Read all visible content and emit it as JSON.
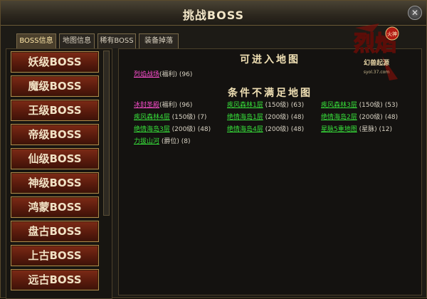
{
  "window": {
    "title": "挑战BOSS",
    "close_symbol": "✕"
  },
  "tabs": [
    {
      "label": "BOSS信息",
      "active": true
    },
    {
      "label": "地图信息",
      "active": false
    },
    {
      "label": "稀有BOSS",
      "active": false
    },
    {
      "label": "装备掉落",
      "active": false
    }
  ],
  "boss_levels": [
    "妖级BOSS",
    "魔级BOSS",
    "王级BOSS",
    "帝级BOSS",
    "仙级BOSS",
    "神级BOSS",
    "鸿蒙BOSS",
    "盘古BOSS",
    "上古BOSS",
    "远古BOSS"
  ],
  "section_enterable": {
    "heading": "可进入地图",
    "maps": [
      {
        "name": "烈焰战场",
        "tag": "(福利)",
        "level": "(96)",
        "color": "pink"
      }
    ]
  },
  "section_locked": {
    "heading": "条件不满足地图",
    "maps": [
      {
        "name": "冰封圣殿",
        "tag": "(福利)",
        "level": "(96)",
        "color": "pink"
      },
      {
        "name": "疾风森林1层",
        "tag": "(150级)",
        "level": "(63)",
        "color": "green"
      },
      {
        "name": "疾风森林3层",
        "tag": "(150级)",
        "level": "(53)",
        "color": "green"
      },
      {
        "name": "疾风森林4层",
        "tag": "(150级)",
        "level": "(7)",
        "color": "green"
      },
      {
        "name": "绝情海岛1层",
        "tag": "(200级)",
        "level": "(48)",
        "color": "green"
      },
      {
        "name": "绝情海岛2层",
        "tag": "(200级)",
        "level": "(48)",
        "color": "green"
      },
      {
        "name": "绝情海岛3层",
        "tag": "(200级)",
        "level": "(48)",
        "color": "green"
      },
      {
        "name": "绝情海岛4层",
        "tag": "(200级)",
        "level": "(48)",
        "color": "green"
      },
      {
        "name": "星脉5重地图",
        "tag": "(星脉)",
        "level": "(12)",
        "color": "green"
      },
      {
        "name": "力拔山河",
        "tag": "(爵位)",
        "level": "(8)",
        "color": "green"
      }
    ]
  },
  "logo": {
    "main": "烈焰",
    "badge": "火神",
    "sub": "幻兽起源",
    "url": "syol.37.com"
  }
}
